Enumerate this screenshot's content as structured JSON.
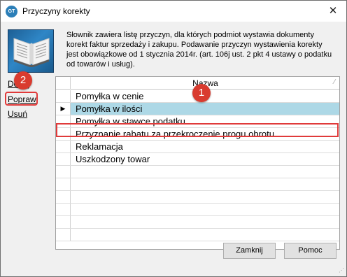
{
  "window": {
    "title": "Przyczyny korekty",
    "icon_text": "GT",
    "close_glyph": "✕"
  },
  "description": "Słownik zawiera listę przyczyn, dla których podmiot wystawia dokumenty korekt faktur sprzedaży i zakupu. Podawanie przyczyn wystawienia korekty jest obowiązkowe od 1 stycznia 2014r. (art. 106j ust. 2 pkt 4 ustawy o podatku od towarów i usług).",
  "side_links": {
    "add": "Dodaj",
    "edit": "Popraw",
    "delete": "Usuń"
  },
  "grid": {
    "column_header": "Nazwa",
    "sort_glyph": "∕",
    "current_row_marker": "▶",
    "rows": [
      "Pomyłka w cenie",
      "Pomyłka w ilości",
      "Pomyłka w stawce podatku",
      "Przyznanie rabatu za przekroczenie progu obrotu",
      "Reklamacja",
      "Uszkodzony towar",
      "",
      "",
      "",
      "",
      "",
      ""
    ],
    "selected_index": 1
  },
  "annotations": {
    "badge_1": "1",
    "badge_2": "2"
  },
  "buttons": {
    "close": "Zamknij",
    "help": "Pomoc"
  },
  "colors": {
    "selection": "#add8e6",
    "highlight": "#e03a3a",
    "badge": "#d93b2f"
  },
  "icons": {
    "app": "app-logo-icon",
    "image": "book-icon",
    "close": "close-icon",
    "row_marker": "current-row-arrow-icon",
    "grip": "resize-grip-icon"
  }
}
